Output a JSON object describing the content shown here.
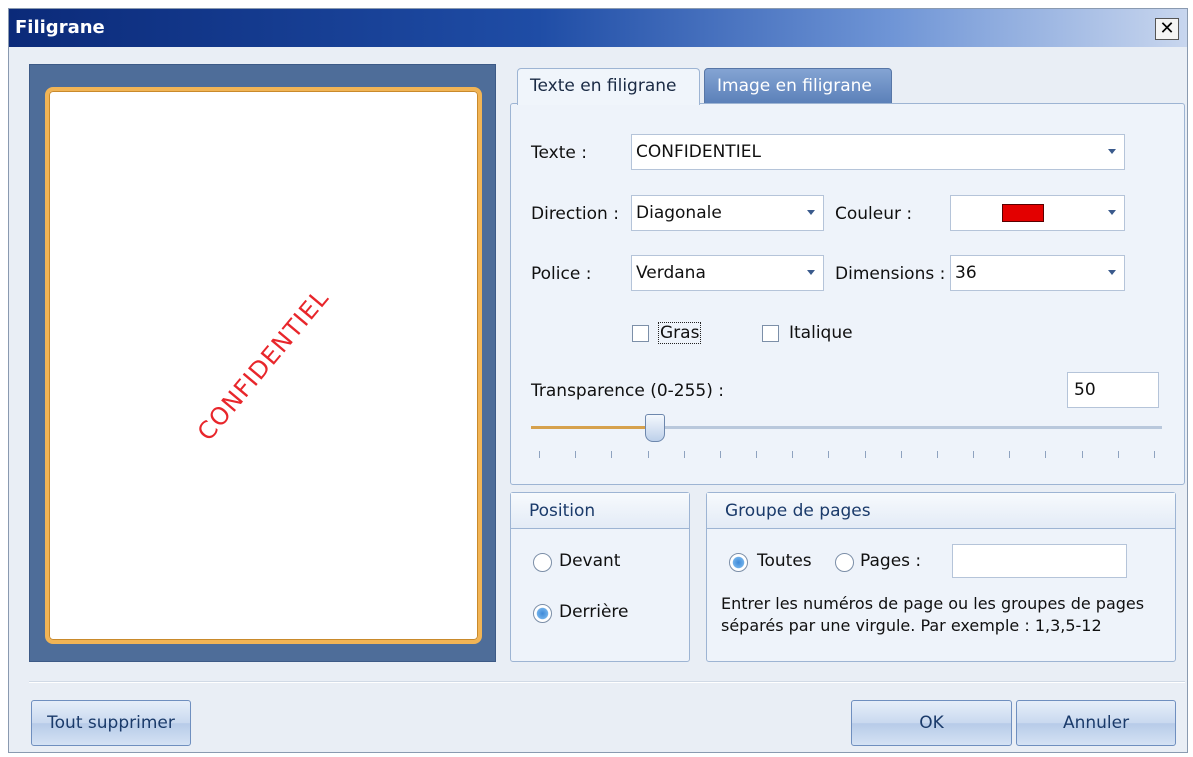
{
  "window": {
    "title": "Filigrane",
    "close": "✕"
  },
  "preview": {
    "watermark_text": "CONFIDENTIEL",
    "watermark_color": "#e8262b"
  },
  "tabs": [
    {
      "label": "Texte en filigrane",
      "active": true
    },
    {
      "label": "Image en filigrane",
      "active": false
    }
  ],
  "text_tab": {
    "text_label": "Texte :",
    "text_value": "CONFIDENTIEL",
    "direction_label": "Direction :",
    "direction_value": "Diagonale",
    "color_label": "Couleur :",
    "color_value": "#e30000",
    "font_label": "Police :",
    "font_value": "Verdana",
    "size_label": "Dimensions :",
    "size_value": "36",
    "bold_label": "Gras",
    "bold_checked": false,
    "italic_label": "Italique",
    "italic_checked": false,
    "transparency_label": "Transparence (0-255) :",
    "transparency_value": "50",
    "transparency_range": [
      0,
      255
    ]
  },
  "position": {
    "title": "Position",
    "options": [
      {
        "label": "Devant",
        "selected": false
      },
      {
        "label": "Derrière",
        "selected": true
      }
    ]
  },
  "page_group": {
    "title": "Groupe de pages",
    "all_label": "Toutes",
    "all_selected": true,
    "pages_label": "Pages :",
    "pages_selected": false,
    "pages_value": "",
    "hint": "Entrer les numéros de page ou les groupes de pages séparés par une virgule. Par exemple : 1,3,5-12"
  },
  "buttons": {
    "clear": "Tout supprimer",
    "ok": "OK",
    "cancel": "Annuler"
  }
}
